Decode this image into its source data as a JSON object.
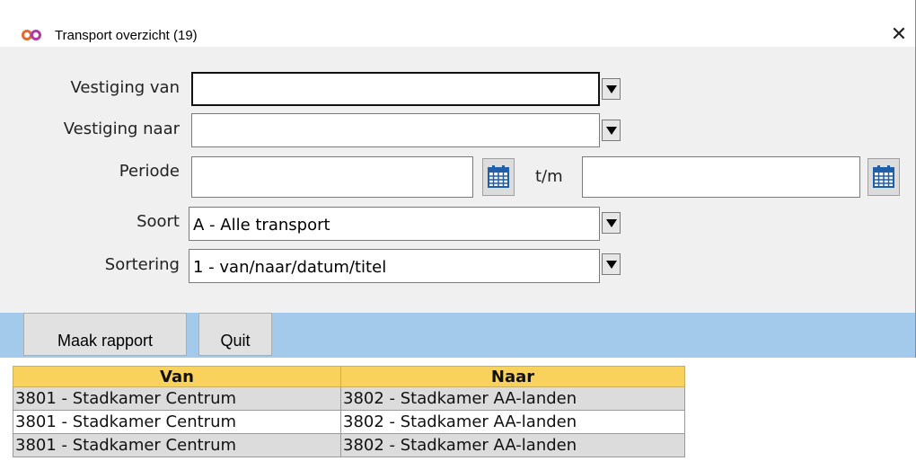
{
  "window": {
    "title": "Transport overzicht (19)",
    "close_glyph": "✕",
    "app_icon": "infinity-icon"
  },
  "form": {
    "vestiging_van": {
      "label": "Vestiging van",
      "value": ""
    },
    "vestiging_naar": {
      "label": "Vestiging naar",
      "value": ""
    },
    "periode": {
      "label": "Periode",
      "from_value": "",
      "separator": "t/m",
      "to_value": ""
    },
    "soort": {
      "label": "Soort",
      "value": "A - Alle transport"
    },
    "sortering": {
      "label": "Sortering",
      "value": "1 - van/naar/datum/titel"
    }
  },
  "toolbar": {
    "maak_rapport_label": "Maak rapport",
    "quit_label": "Quit"
  },
  "table": {
    "columns": [
      "Van",
      "Naar"
    ],
    "rows": [
      [
        "3801 - Stadkamer Centrum",
        "3802 - Stadkamer AA-landen"
      ],
      [
        "3801 - Stadkamer Centrum",
        "3802 - Stadkamer AA-landen"
      ],
      [
        "3801 - Stadkamer Centrum",
        "3802 - Stadkamer AA-landen"
      ]
    ]
  },
  "colors": {
    "toolbar_bg": "#a3c9eb",
    "header_bg": "#f8d25c",
    "form_bg": "#f0f0f0",
    "row_alt_bg": "#dcdcdc"
  }
}
